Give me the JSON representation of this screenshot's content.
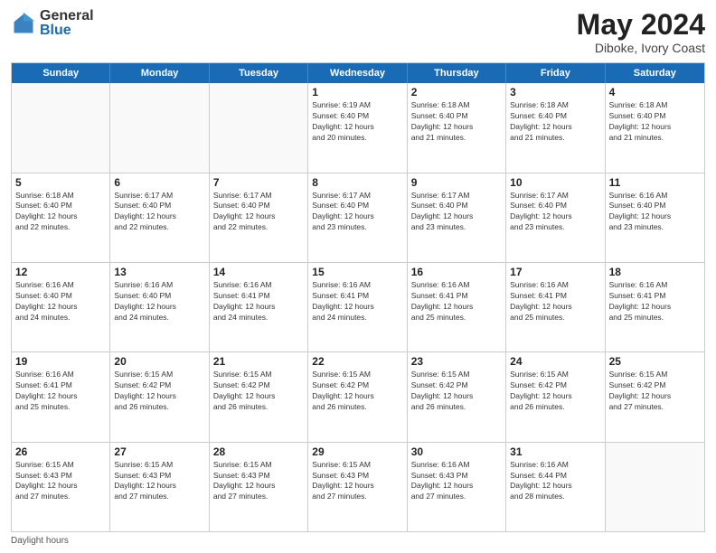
{
  "header": {
    "logo_general": "General",
    "logo_blue": "Blue",
    "month_year": "May 2024",
    "location": "Diboke, Ivory Coast"
  },
  "days_of_week": [
    "Sunday",
    "Monday",
    "Tuesday",
    "Wednesday",
    "Thursday",
    "Friday",
    "Saturday"
  ],
  "footer_text": "Daylight hours",
  "weeks": [
    {
      "cells": [
        {
          "day": "",
          "empty": true,
          "lines": []
        },
        {
          "day": "",
          "empty": true,
          "lines": []
        },
        {
          "day": "",
          "empty": true,
          "lines": []
        },
        {
          "day": "1",
          "empty": false,
          "lines": [
            "Sunrise: 6:19 AM",
            "Sunset: 6:40 PM",
            "Daylight: 12 hours",
            "and 20 minutes."
          ]
        },
        {
          "day": "2",
          "empty": false,
          "lines": [
            "Sunrise: 6:18 AM",
            "Sunset: 6:40 PM",
            "Daylight: 12 hours",
            "and 21 minutes."
          ]
        },
        {
          "day": "3",
          "empty": false,
          "lines": [
            "Sunrise: 6:18 AM",
            "Sunset: 6:40 PM",
            "Daylight: 12 hours",
            "and 21 minutes."
          ]
        },
        {
          "day": "4",
          "empty": false,
          "lines": [
            "Sunrise: 6:18 AM",
            "Sunset: 6:40 PM",
            "Daylight: 12 hours",
            "and 21 minutes."
          ]
        }
      ]
    },
    {
      "cells": [
        {
          "day": "5",
          "empty": false,
          "lines": [
            "Sunrise: 6:18 AM",
            "Sunset: 6:40 PM",
            "Daylight: 12 hours",
            "and 22 minutes."
          ]
        },
        {
          "day": "6",
          "empty": false,
          "lines": [
            "Sunrise: 6:17 AM",
            "Sunset: 6:40 PM",
            "Daylight: 12 hours",
            "and 22 minutes."
          ]
        },
        {
          "day": "7",
          "empty": false,
          "lines": [
            "Sunrise: 6:17 AM",
            "Sunset: 6:40 PM",
            "Daylight: 12 hours",
            "and 22 minutes."
          ]
        },
        {
          "day": "8",
          "empty": false,
          "lines": [
            "Sunrise: 6:17 AM",
            "Sunset: 6:40 PM",
            "Daylight: 12 hours",
            "and 23 minutes."
          ]
        },
        {
          "day": "9",
          "empty": false,
          "lines": [
            "Sunrise: 6:17 AM",
            "Sunset: 6:40 PM",
            "Daylight: 12 hours",
            "and 23 minutes."
          ]
        },
        {
          "day": "10",
          "empty": false,
          "lines": [
            "Sunrise: 6:17 AM",
            "Sunset: 6:40 PM",
            "Daylight: 12 hours",
            "and 23 minutes."
          ]
        },
        {
          "day": "11",
          "empty": false,
          "lines": [
            "Sunrise: 6:16 AM",
            "Sunset: 6:40 PM",
            "Daylight: 12 hours",
            "and 23 minutes."
          ]
        }
      ]
    },
    {
      "cells": [
        {
          "day": "12",
          "empty": false,
          "lines": [
            "Sunrise: 6:16 AM",
            "Sunset: 6:40 PM",
            "Daylight: 12 hours",
            "and 24 minutes."
          ]
        },
        {
          "day": "13",
          "empty": false,
          "lines": [
            "Sunrise: 6:16 AM",
            "Sunset: 6:40 PM",
            "Daylight: 12 hours",
            "and 24 minutes."
          ]
        },
        {
          "day": "14",
          "empty": false,
          "lines": [
            "Sunrise: 6:16 AM",
            "Sunset: 6:41 PM",
            "Daylight: 12 hours",
            "and 24 minutes."
          ]
        },
        {
          "day": "15",
          "empty": false,
          "lines": [
            "Sunrise: 6:16 AM",
            "Sunset: 6:41 PM",
            "Daylight: 12 hours",
            "and 24 minutes."
          ]
        },
        {
          "day": "16",
          "empty": false,
          "lines": [
            "Sunrise: 6:16 AM",
            "Sunset: 6:41 PM",
            "Daylight: 12 hours",
            "and 25 minutes."
          ]
        },
        {
          "day": "17",
          "empty": false,
          "lines": [
            "Sunrise: 6:16 AM",
            "Sunset: 6:41 PM",
            "Daylight: 12 hours",
            "and 25 minutes."
          ]
        },
        {
          "day": "18",
          "empty": false,
          "lines": [
            "Sunrise: 6:16 AM",
            "Sunset: 6:41 PM",
            "Daylight: 12 hours",
            "and 25 minutes."
          ]
        }
      ]
    },
    {
      "cells": [
        {
          "day": "19",
          "empty": false,
          "lines": [
            "Sunrise: 6:16 AM",
            "Sunset: 6:41 PM",
            "Daylight: 12 hours",
            "and 25 minutes."
          ]
        },
        {
          "day": "20",
          "empty": false,
          "lines": [
            "Sunrise: 6:15 AM",
            "Sunset: 6:42 PM",
            "Daylight: 12 hours",
            "and 26 minutes."
          ]
        },
        {
          "day": "21",
          "empty": false,
          "lines": [
            "Sunrise: 6:15 AM",
            "Sunset: 6:42 PM",
            "Daylight: 12 hours",
            "and 26 minutes."
          ]
        },
        {
          "day": "22",
          "empty": false,
          "lines": [
            "Sunrise: 6:15 AM",
            "Sunset: 6:42 PM",
            "Daylight: 12 hours",
            "and 26 minutes."
          ]
        },
        {
          "day": "23",
          "empty": false,
          "lines": [
            "Sunrise: 6:15 AM",
            "Sunset: 6:42 PM",
            "Daylight: 12 hours",
            "and 26 minutes."
          ]
        },
        {
          "day": "24",
          "empty": false,
          "lines": [
            "Sunrise: 6:15 AM",
            "Sunset: 6:42 PM",
            "Daylight: 12 hours",
            "and 26 minutes."
          ]
        },
        {
          "day": "25",
          "empty": false,
          "lines": [
            "Sunrise: 6:15 AM",
            "Sunset: 6:42 PM",
            "Daylight: 12 hours",
            "and 27 minutes."
          ]
        }
      ]
    },
    {
      "cells": [
        {
          "day": "26",
          "empty": false,
          "lines": [
            "Sunrise: 6:15 AM",
            "Sunset: 6:43 PM",
            "Daylight: 12 hours",
            "and 27 minutes."
          ]
        },
        {
          "day": "27",
          "empty": false,
          "lines": [
            "Sunrise: 6:15 AM",
            "Sunset: 6:43 PM",
            "Daylight: 12 hours",
            "and 27 minutes."
          ]
        },
        {
          "day": "28",
          "empty": false,
          "lines": [
            "Sunrise: 6:15 AM",
            "Sunset: 6:43 PM",
            "Daylight: 12 hours",
            "and 27 minutes."
          ]
        },
        {
          "day": "29",
          "empty": false,
          "lines": [
            "Sunrise: 6:15 AM",
            "Sunset: 6:43 PM",
            "Daylight: 12 hours",
            "and 27 minutes."
          ]
        },
        {
          "day": "30",
          "empty": false,
          "lines": [
            "Sunrise: 6:16 AM",
            "Sunset: 6:43 PM",
            "Daylight: 12 hours",
            "and 27 minutes."
          ]
        },
        {
          "day": "31",
          "empty": false,
          "lines": [
            "Sunrise: 6:16 AM",
            "Sunset: 6:44 PM",
            "Daylight: 12 hours",
            "and 28 minutes."
          ]
        },
        {
          "day": "",
          "empty": true,
          "lines": []
        }
      ]
    }
  ]
}
